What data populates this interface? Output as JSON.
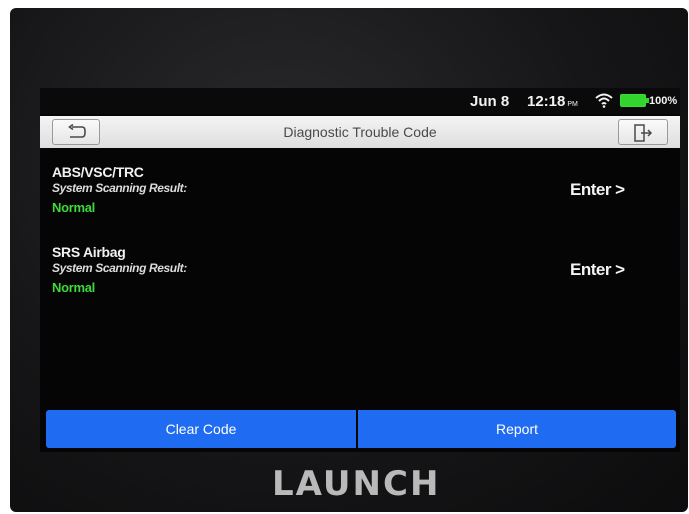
{
  "status_bar": {
    "date": "Jun 8",
    "time": "12:18",
    "ampm": "PM",
    "battery_percent": "100%",
    "icons": [
      "wifi-icon",
      "battery-icon"
    ]
  },
  "title_bar": {
    "title": "Diagnostic Trouble Code",
    "back_icon": "return-arrow-icon",
    "exit_icon": "exit-door-icon"
  },
  "systems": [
    {
      "name": "ABS/VSC/TRC",
      "label": "System Scanning Result:",
      "result": "Normal",
      "action": "Enter >"
    },
    {
      "name": "SRS Airbag",
      "label": "System Scanning Result:",
      "result": "Normal",
      "action": "Enter >"
    }
  ],
  "bottom_bar": {
    "clear_label": "Clear Code",
    "report_label": "Report"
  },
  "device": {
    "brand": "LAUNCH"
  },
  "colors": {
    "accent_blue": "#1f6cf2",
    "status_green": "#3ed93e",
    "battery_green": "#32d42e"
  }
}
